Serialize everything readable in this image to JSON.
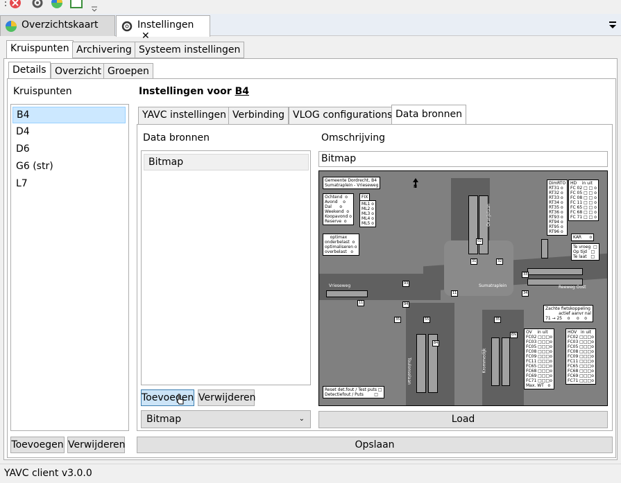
{
  "doc_tabs": [
    {
      "label": "Overzichtskaart"
    },
    {
      "label": "Instellingen",
      "close": "✕"
    }
  ],
  "top_tabs": [
    "Kruispunten",
    "Archivering",
    "Systeem instellingen"
  ],
  "sub_tabs": [
    "Details",
    "Overzicht",
    "Groepen"
  ],
  "left": {
    "title": "Kruispunten",
    "items": [
      "B4",
      "D4",
      "D6",
      "G6 (str)",
      "L7"
    ],
    "add_label": "Toevoegen",
    "remove_label": "Verwijderen"
  },
  "right": {
    "title_prefix": "Instellingen voor ",
    "title_key": "B4",
    "tabs": [
      "YAVC instellingen",
      "Verbinding",
      "VLOG configurations",
      "Data bronnen"
    ],
    "sources_title": "Data bronnen",
    "sources": [
      "Bitmap"
    ],
    "add_label": "Toevoegen",
    "remove_label": "Verwijderen",
    "type_value": "Bitmap",
    "desc_title": "Omschrijving",
    "desc_value": "Bitmap",
    "load_label": "Load",
    "save_label": "Opslaan"
  },
  "map_text": {
    "header": "Gemeente Dordrecht, B4\nSumatraplein - Vrieseweg",
    "periods": "Ochtend  o\nAvond    o\nDal      o\nWeekend  o\nKoopavond o\nReserve  o",
    "fix": "FIX",
    "ml": "ML1 o\nML2 o\nML3 o\nML4 o\nML5 o",
    "optimax": "    optimax\nonderbelast  o\noptimaliseren o\noverbelast   o",
    "dimrt": "DimRTO\nRT31 o\nRT32 o\nRT33 o\nRT34 o\nRT35 o\nRT36 o\nRT93 o\nRT94 o\nRT95 o\nRT96 o",
    "hd": "HD    in uit\nFC 02 □ □ o\nFC 05 □ □ o\nFC 08 □ □ o\nFC 11 □ □ o\nFC 65 □ □ o\nFC 68 □ □ o\nFC 71 □ □ o",
    "kar": "KAR      o",
    "timing": "Te vroeg  □\nOp tijd   □\nTe laat   □",
    "fiets": "Zachte fietskoppeling\n          actief aanvr nal\n71 → 25    o     o    o",
    "ov": "OV    in uit\nFC02 □□□o\nFC03 □□□o\nFC05 □□□o\nFC08 □□□o\nFC09 □□□o\nFC11 □□□o\nFC65 □□□o\nFC68 □□□o\nFC69 □□□o\nFC71 □□□o\nMax. WT   o",
    "hov": "HOV   in uit\nFC02 □□□o\nFC03 □□□o\nFC05 □□□o\nFC08 □□□o\nFC09 □□□o\nFC11 □□□o\nFC65 □□□o\nFC68 □□□o\nFC69 □□□o\nFC71 □□□o",
    "reset": "Reset det.fout / Test puts □\nDetectiefout / Puts        □",
    "street_vrieseweg": "Vrieseweg",
    "street_sumatraplein": "Sumatraplein",
    "street_reeweg": "Reeweg Oost",
    "street_oranje": "Oranjelaan",
    "street_toulonselaan": "Toulonselaan",
    "street_kromme": "Krommedijk",
    "north": "N"
  },
  "status": "YAVC client v3.0.0",
  "colors": {
    "selection": "#cce8ff",
    "tabstrip": "#e9eef5",
    "map_bg": "#808080"
  }
}
